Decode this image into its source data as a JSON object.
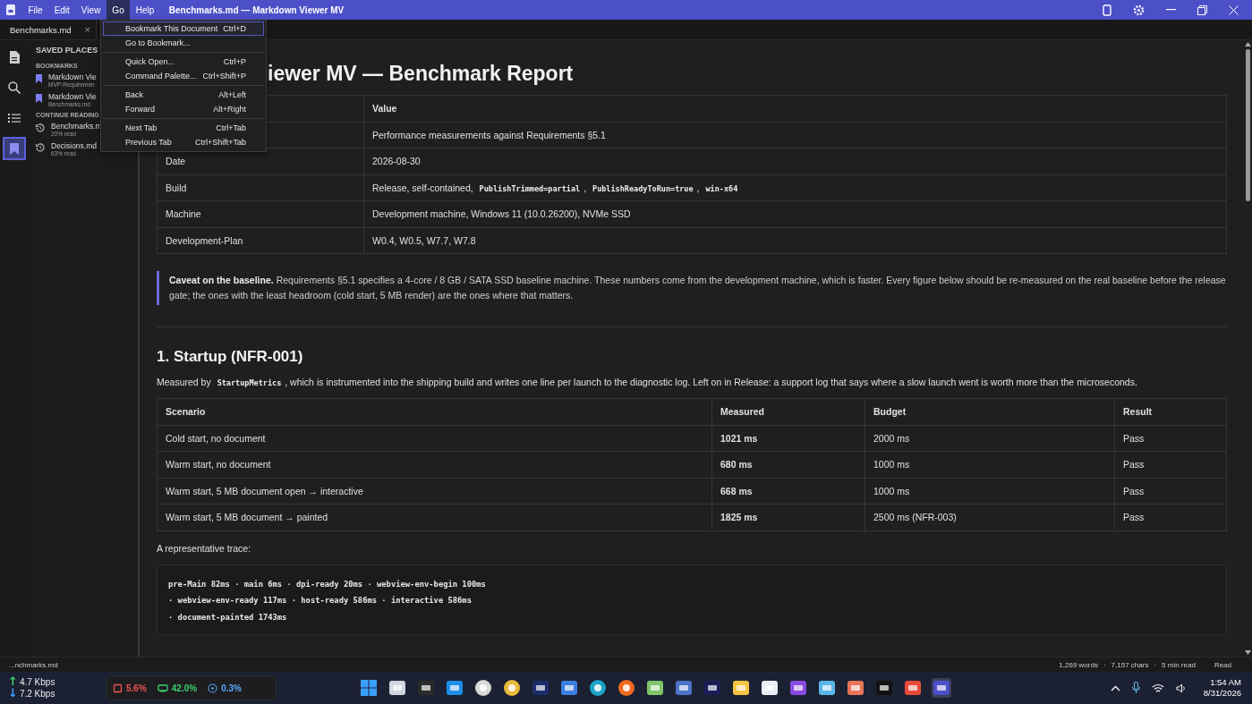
{
  "titlebar": {
    "menus": [
      {
        "label": "File",
        "selected": false
      },
      {
        "label": "Edit",
        "selected": false
      },
      {
        "label": "View",
        "selected": false
      },
      {
        "label": "Go",
        "selected": true
      },
      {
        "label": "Help",
        "selected": false
      }
    ],
    "title": "Benchmarks.md — Markdown Viewer MV"
  },
  "tab": {
    "label": "Benchmarks.md",
    "close": "×"
  },
  "activity_bar": [
    {
      "kind": "file",
      "selected": false
    },
    {
      "kind": "search",
      "selected": false
    },
    {
      "kind": "list",
      "selected": false
    },
    {
      "kind": "bookmark",
      "selected": true
    }
  ],
  "sidebar": {
    "title": "SAVED PLACES",
    "sections": [
      {
        "kind": "bookmark",
        "heading": "BOOKMARKS",
        "items": [
          {
            "title": "Markdown Vie",
            "subtitle": "MVP-Requiremen"
          },
          {
            "title": "Markdown Vie",
            "subtitle": "Benchmarks.md"
          }
        ]
      },
      {
        "kind": "history",
        "heading": "CONTINUE READING",
        "items": [
          {
            "title": "Benchmarks.m",
            "subtitle": "20% read"
          },
          {
            "title": "Decisions.md",
            "subtitle": "63% read"
          }
        ]
      }
    ]
  },
  "go_menu": [
    [
      {
        "label": "Bookmark This Document",
        "shortcut": "Ctrl+D",
        "selected": true
      },
      {
        "label": "Go to Bookmark...",
        "selected": false
      }
    ],
    [
      {
        "label": "Quick Open...",
        "shortcut": "Ctrl+P",
        "selected": false
      },
      {
        "label": "Command Palette...",
        "shortcut": "Ctrl+Shift+P",
        "selected": false
      }
    ],
    [
      {
        "label": "Back",
        "shortcut": "Alt+Left",
        "selected": false
      },
      {
        "label": "Forward",
        "shortcut": "Alt+Right",
        "selected": false
      }
    ],
    [
      {
        "label": "Next Tab",
        "shortcut": "Ctrl+Tab",
        "selected": false
      },
      {
        "label": "Previous Tab",
        "shortcut": "Ctrl+Shift+Tab",
        "selected": false
      }
    ]
  ],
  "document": {
    "title": "iewer MV — Benchmark Report",
    "meta_table": {
      "header": "Value",
      "rows": [
        {
          "value": [
            {
              "text": "Performance measurements against Requirements §5.1"
            }
          ]
        },
        {
          "key": "Date",
          "value": [
            {
              "text": "2026-08-30"
            }
          ]
        },
        {
          "key": "Build",
          "value": [
            {
              "text": "Release, self-contained, "
            },
            {
              "code": "PublishTrimmed=partial"
            },
            {
              "text": ", "
            },
            {
              "code": "PublishReadyToRun=true"
            },
            {
              "text": ", "
            },
            {
              "code": "win-x64"
            }
          ]
        },
        {
          "key": "Machine",
          "value": [
            {
              "text": "Development machine, Windows 11 (10.0.26200), NVMe SSD"
            }
          ]
        },
        {
          "key": "Development-Plan",
          "value": [
            {
              "text": "W0.4, W0.5, W7.7, W7.8"
            }
          ]
        }
      ]
    },
    "callout": "**Caveat on the baseline.** Requirements §5.1 specifies a 4-core / 8 GB / SATA SSD baseline machine. These numbers come from the development machine, which is faster. Every figure below should be re-measured on the real baseline before the release gate; the ones with the least headroom (cold start, 5 MB render) are the ones where that matters.",
    "section_heading": "1. Startup (NFR-001)",
    "intro": [
      {
        "text": "Measured by "
      },
      {
        "code": "StartupMetrics"
      },
      {
        "text": ", which is instrumented into the shipping build and writes one line per launch to the diagnostic log. Left on in Release: a support log that says where a slow launch went is worth more than the microseconds."
      }
    ],
    "results_table": {
      "columns": [
        {
          "label": "Scenario",
          "bold": false
        },
        {
          "label": "Measured",
          "bold": true
        },
        {
          "label": "Budget",
          "bold": false
        },
        {
          "label": "Result",
          "bold": false
        }
      ],
      "rows": [
        [
          "Cold start, no document",
          "1021 ms",
          "2000 ms",
          "Pass"
        ],
        [
          "Warm start, no document",
          "680 ms",
          "1000 ms",
          "Pass"
        ],
        [
          "Warm start, 5 MB document open → interactive",
          "668 ms",
          "1000 ms",
          "Pass"
        ],
        [
          "Warm start, 5 MB document → painted",
          "1825 ms",
          "2500 ms (NFR-003)",
          "Pass"
        ]
      ]
    },
    "trace_label": "A representative trace:",
    "trace_lines": [
      "pre-Main 82ms · main 6ms · dpi-ready 20ms · webview-env-begin 100ms",
      "· webview-env-ready 117ms · host-ready 586ms · interactive 586ms",
      "· document-painted 1743ms"
    ]
  },
  "status_bar": {
    "file": "...nchmarks.md",
    "stats": [
      "1,269 words",
      "7,157 chars",
      "5 min read"
    ],
    "separator": "·",
    "mode": "Read"
  },
  "taskbar": {
    "network": [
      {
        "arrow": "↑",
        "rate": "4.7 Kbps",
        "color": "#3ccf6e"
      },
      {
        "arrow": "↓",
        "rate": "7.2 Kbps",
        "color": "#4a9eff"
      }
    ],
    "meters": [
      {
        "kind": "cpu",
        "value": "5.6%",
        "color": "#f05454"
      },
      {
        "kind": "memory",
        "value": "42.0%",
        "color": "#3ccf6e"
      },
      {
        "kind": "disk",
        "value": "0.3%",
        "color": "#5aa7ff"
      }
    ],
    "time": "1:54 AM",
    "date": "8/31/2026"
  }
}
